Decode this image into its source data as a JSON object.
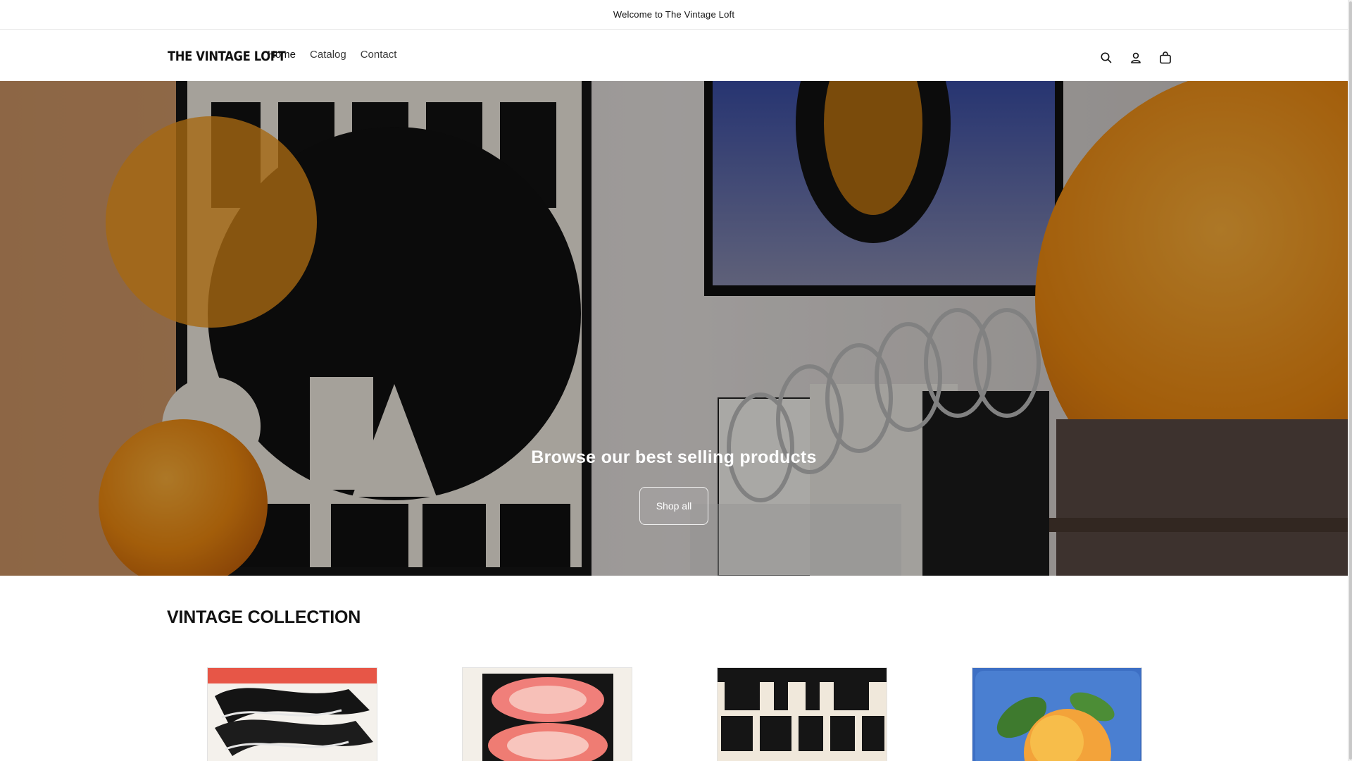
{
  "announcement": {
    "text": "Welcome to The Vintage Loft"
  },
  "header": {
    "logo": "THE VINTAGE LOFT",
    "nav": [
      {
        "label": "Home"
      },
      {
        "label": "Catalog"
      },
      {
        "label": "Contact"
      }
    ],
    "icons": [
      "search-icon",
      "account-icon",
      "cart-icon"
    ]
  },
  "hero": {
    "title": "Browse our best selling products",
    "button_label": "Shop all"
  },
  "collection": {
    "title": "VINTAGE COLLECTION",
    "products": [
      {
        "image": "abstract-wave-poster"
      },
      {
        "image": "pink-ripple-poster"
      },
      {
        "image": "the-shape-poster"
      },
      {
        "image": "peach-illustration-poster"
      }
    ]
  },
  "colors": {
    "text": "#121212",
    "border": "#e6e6e6",
    "hero_overlay": "rgba(0,0,0,0.32)",
    "accent_orange": "#f08a10"
  }
}
